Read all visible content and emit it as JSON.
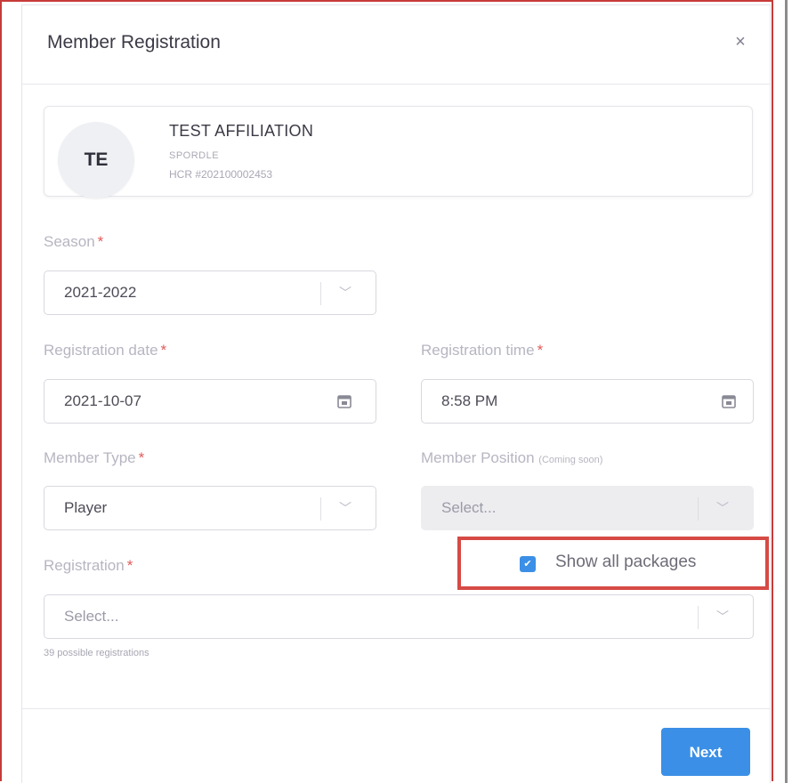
{
  "modal": {
    "title": "Member Registration",
    "close_glyph": "×"
  },
  "member": {
    "initials": "TE",
    "name": "TEST AFFILIATION",
    "organization": "SPORDLE",
    "hcr": "HCR #202100002453"
  },
  "form": {
    "required_marker": "*",
    "season": {
      "label": "Season",
      "value": "2021-2022"
    },
    "registration_date": {
      "label": "Registration date",
      "value": "2021-10-07"
    },
    "registration_time": {
      "label": "Registration time",
      "value": "8:58 PM"
    },
    "member_type": {
      "label": "Member Type",
      "value": "Player"
    },
    "member_position": {
      "label": "Member Position",
      "note": "(Coming soon)",
      "placeholder": "Select..."
    },
    "registration": {
      "label": "Registration",
      "placeholder": "Select...",
      "help": "39 possible registrations"
    },
    "show_all_packages": {
      "label": "Show all packages",
      "checked": true
    }
  },
  "footer": {
    "next_label": "Next"
  },
  "colors": {
    "accent": "#3b8fe6",
    "required": "#e35a5a",
    "highlight_border": "#d64a45"
  },
  "icons": {
    "close": "close-icon",
    "calendar": "calendar-icon",
    "chevron": "chevron-down-icon",
    "check": "checkmark-icon"
  }
}
